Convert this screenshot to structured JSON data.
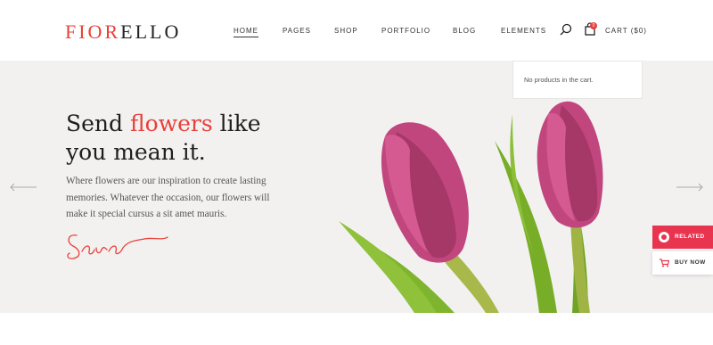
{
  "header": {
    "logo_part1": "FIOR",
    "logo_part2": "ELLO",
    "nav": [
      "HOME",
      "PAGES",
      "SHOP",
      "PORTFOLIO",
      "BLOG",
      "ELEMENTS"
    ],
    "active_nav": "HOME",
    "cart_label": "CART ($0)",
    "cart_count": "0"
  },
  "cart_dropdown": {
    "message": "No products in the cart."
  },
  "hero": {
    "headline_pre": "Send ",
    "headline_highlight": "flowers",
    "headline_post": " like you mean it.",
    "description": "Where flowers are our inspiration to create lasting memories. Whatever the occasion, our flowers will make it special cursus a sit amet mauris.",
    "signature_text": "Sara"
  },
  "side_buttons": {
    "related": "RELATED",
    "buy_now": "BUY NOW"
  },
  "colors": {
    "accent": "#e8403a",
    "related_bg": "#e8344e",
    "hero_bg": "#f2f1f0",
    "tulip_petal": "#c1467e",
    "leaf": "#7fb52e"
  },
  "icons": [
    "search-icon",
    "cart-icon",
    "arrow-left-icon",
    "arrow-right-icon",
    "related-icon",
    "cart-small-icon"
  ]
}
